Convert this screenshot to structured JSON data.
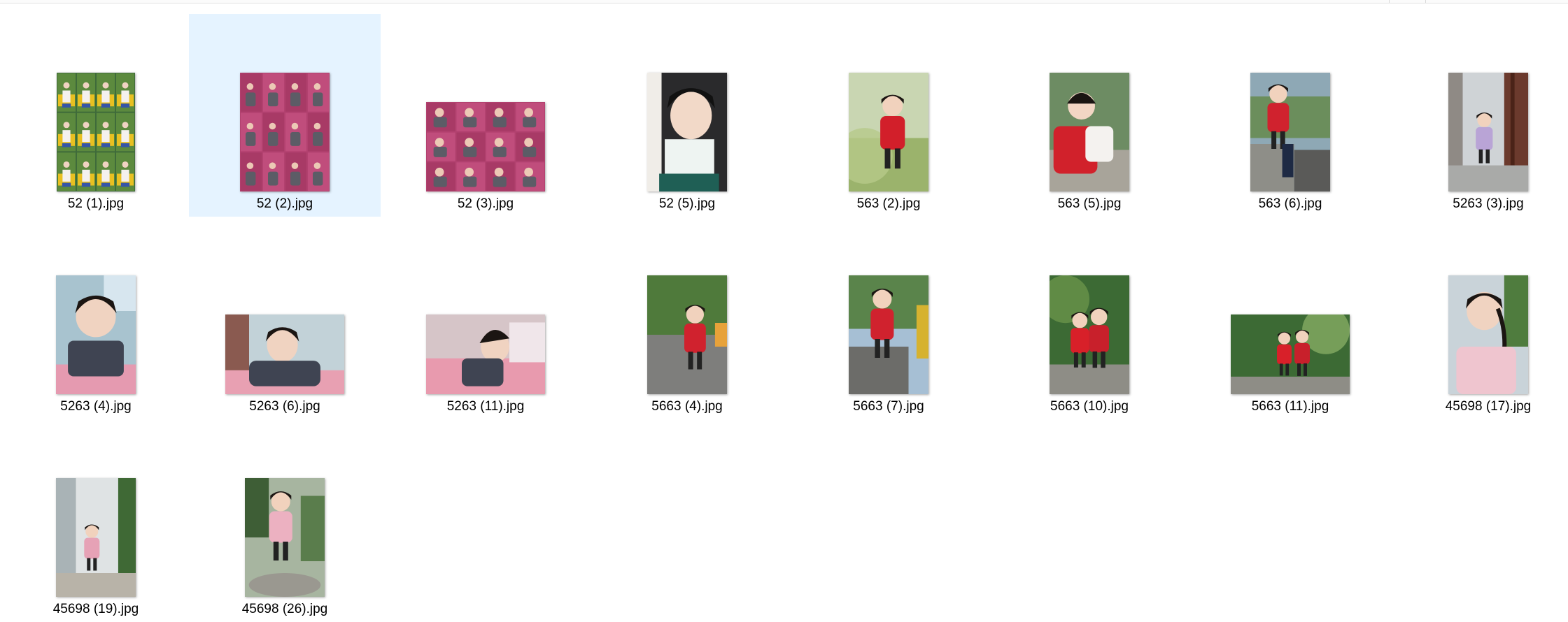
{
  "files": [
    {
      "name": "52 (1).jpg",
      "kind": "collage-yellow",
      "selected": false
    },
    {
      "name": "52 (2).jpg",
      "kind": "collage-pink",
      "selected": true
    },
    {
      "name": "52 (3).jpg",
      "kind": "collage-pink-wide",
      "selected": false
    },
    {
      "name": "52 (5).jpg",
      "kind": "portrait-hanfu",
      "selected": false
    },
    {
      "name": "563 (2).jpg",
      "kind": "portrait-red-garden",
      "selected": false
    },
    {
      "name": "563 (5).jpg",
      "kind": "portrait-red-sitting",
      "selected": false
    },
    {
      "name": "563 (6).jpg",
      "kind": "portrait-red-wall",
      "selected": false
    },
    {
      "name": "5263 (3).jpg",
      "kind": "portrait-purple-corridor",
      "selected": false
    },
    {
      "name": "5263 (4).jpg",
      "kind": "portrait-plaid-bed",
      "selected": false
    },
    {
      "name": "5263 (6).jpg",
      "kind": "landscape-plaid-bed",
      "selected": false
    },
    {
      "name": "5263 (11).jpg",
      "kind": "landscape-plaid-lying",
      "selected": false
    },
    {
      "name": "5663 (4).jpg",
      "kind": "portrait-red-street",
      "selected": false
    },
    {
      "name": "5663 (7).jpg",
      "kind": "portrait-red-ledge",
      "selected": false
    },
    {
      "name": "5663 (10).jpg",
      "kind": "portrait-two-kids",
      "selected": false
    },
    {
      "name": "5663 (11).jpg",
      "kind": "landscape-two-kids",
      "selected": false
    },
    {
      "name": "45698 (17).jpg",
      "kind": "portrait-pink-dress",
      "selected": false
    },
    {
      "name": "45698 (19).jpg",
      "kind": "portrait-pink-walk",
      "selected": false
    },
    {
      "name": "45698 (26).jpg",
      "kind": "portrait-pink-trees",
      "selected": false
    }
  ]
}
